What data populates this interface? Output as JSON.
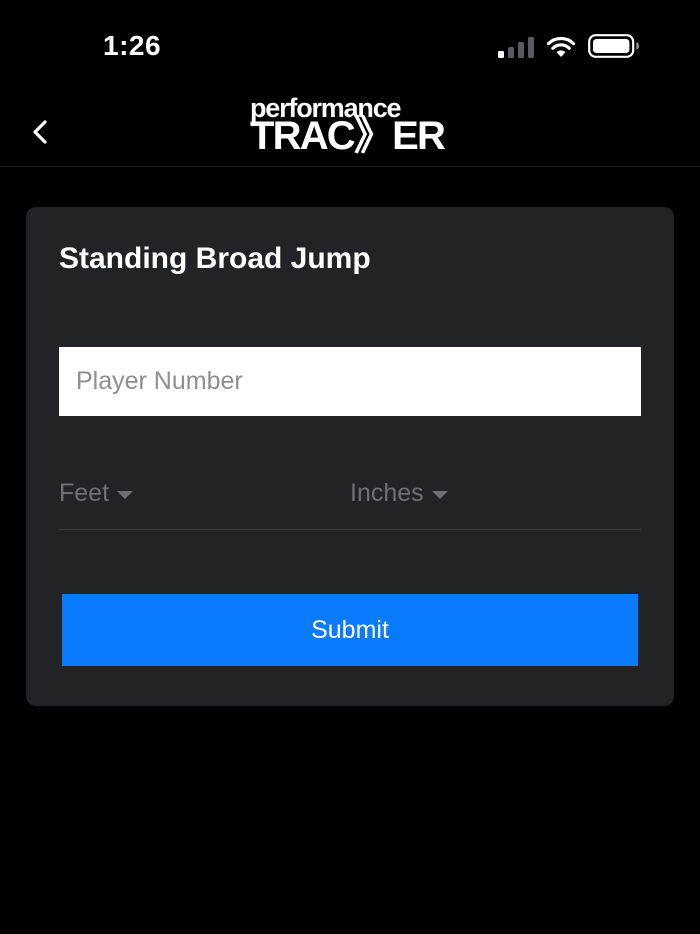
{
  "status_bar": {
    "time": "1:26",
    "signal_icon": "cellular-signal-icon",
    "wifi_icon": "wifi-icon",
    "battery_icon": "battery-icon"
  },
  "nav": {
    "back_icon": "chevron-left-icon",
    "logo_top": "performance",
    "logo_bottom": "TRAC》ER"
  },
  "form": {
    "title": "Standing Broad Jump",
    "player_number_placeholder": "Player Number",
    "feet_label": "Feet",
    "inches_label": "Inches",
    "submit_label": "Submit"
  },
  "colors": {
    "background": "#000000",
    "card": "#222326",
    "accent": "#0a7aff",
    "placeholder": "#6f7075"
  }
}
